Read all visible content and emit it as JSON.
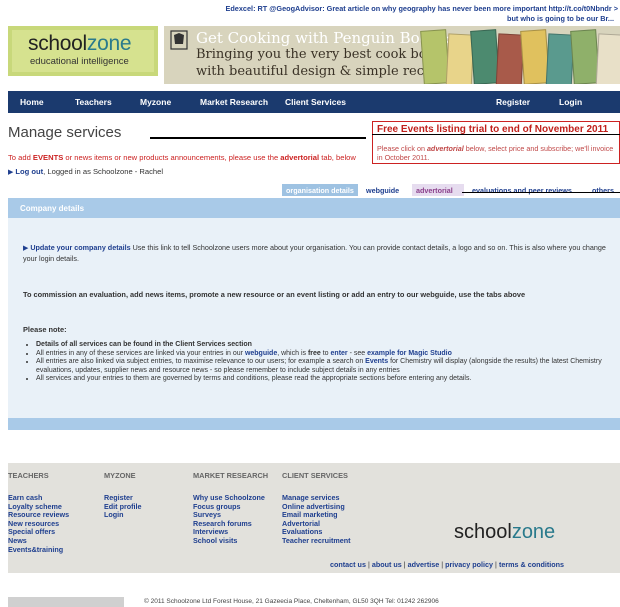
{
  "header": {
    "tweet_line1": "Edexcel: RT @GeogAdvisor: Great article on why geography has never been more important http://t.co/t0Nbndr >",
    "tweet_line2": "but who is going to be our Br...",
    "logo_school": "school",
    "logo_zone": "zone",
    "logo_tagline": "educational intelligence",
    "banner_title": "Get Cooking with Penguin Books:",
    "banner_line1": "Bringing you the very best cook books",
    "banner_line2": "with beautiful design & simple recipes.",
    "banner_book_colors": [
      "#b5c46a",
      "#e8d48a",
      "#4c8a6f",
      "#a85a4a",
      "#e0c15e",
      "#5a9a8e",
      "#8fb06a",
      "#e8e0c8"
    ]
  },
  "nav": {
    "items": [
      "Home",
      "Teachers",
      "Myzone",
      "Market Research",
      "Client Services"
    ],
    "register": "Register",
    "login": "Login"
  },
  "main": {
    "title": "Manage services",
    "promo_title": "Free Events listing trial to end of November 2011",
    "promo_body_pre": "Please click on ",
    "promo_body_em": "advertorial",
    "promo_body_post": " below, select price and subscribe; we'll invoice in October 2011.",
    "notice_pre": "To add ",
    "notice_events": "EVENTS",
    "notice_mid": " or news items or new products announcements, please use the ",
    "notice_adv": "advertorial",
    "notice_post": " tab, below",
    "logout": "Log out",
    "logged_in_as": ", Logged in as Schoolzone - Rachel"
  },
  "tabs": {
    "org": "organisation details",
    "web": "webguide",
    "adv": "advertorial",
    "eval": "evaluations and peer reviews",
    "oth": "others"
  },
  "panel": {
    "head": "Company details",
    "update_link": "Update your company details",
    "update_text": " Use this link to tell Schoolzone users more about your organisation. You can provide contact details, a logo and so on. This is also where you change your login details.",
    "commission": "To commission an evaluation, add news items, promote a new resource or an event listing or add an entry to our webguide, use the tabs above",
    "please_note": "Please note:",
    "b1": "Details of all services can be found in the Client Services section",
    "b2_pre": "All entries in any of these services are linked via your entries in our ",
    "b2_web": "webguide",
    "b2_mid": ", which is ",
    "b2_free": "free",
    "b2_to": " to ",
    "b2_enter": "enter",
    "b2_see": " - see ",
    "b2_example": "example for Magic Studio",
    "b3_pre": "All entries are also linked via subject entries, to maximise relevance to our users; for example a search on ",
    "b3_events": "Events",
    "b3_post": " for Chemistry will display (alongside the results) the latest Chemistry evaluations, updates, supplier news and resource news - so please remember to include subject details in any entries",
    "b4": "All services and your entries to them are governed by terms and conditions, please read the appropriate sections before entering any details."
  },
  "footer": {
    "col1": {
      "head": "TEACHERS",
      "links": [
        "Earn cash",
        "Loyalty scheme",
        "Resource reviews",
        "New resources",
        "Special offers",
        "News",
        "Events&training"
      ]
    },
    "col2": {
      "head": "MYZONE",
      "links": [
        "Register",
        "Edit profile",
        "Login"
      ]
    },
    "col3": {
      "head": "MARKET RESEARCH",
      "links": [
        "Why use Schoolzone",
        "Focus groups",
        "Surveys",
        "Research forums",
        "Interviews",
        "School visits"
      ]
    },
    "col4": {
      "head": "CLIENT SERVICES",
      "links": [
        "Manage services",
        "Online advertising",
        "Email marketing",
        "Advertorial",
        "Evaluations",
        "Teacher recruitment"
      ]
    },
    "logo_school": "school",
    "logo_zone": "zone",
    "bottom_links": [
      "contact us",
      "about us",
      "advertise",
      "privacy policy",
      "terms & conditions"
    ],
    "copyright": "© 2011 Schoolzone Ltd Forest House, 21 Gazeecia Place, Cheltenham, GL50 3QH Tel: 01242 262906"
  }
}
